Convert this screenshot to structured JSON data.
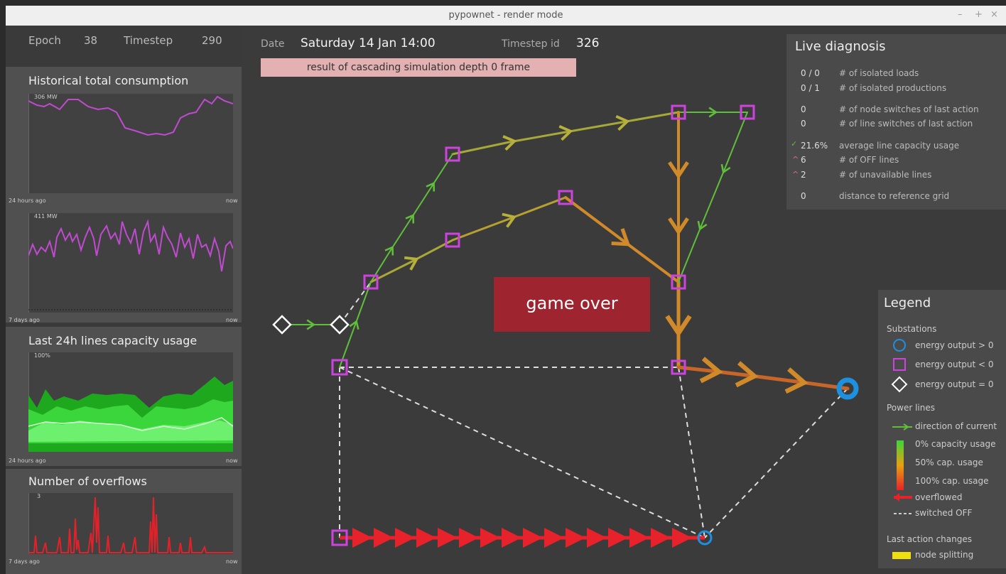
{
  "window": {
    "title": "pypownet - render mode",
    "controls": [
      "–",
      "+",
      "×"
    ]
  },
  "sidebar": {
    "epoch_label": "Epoch",
    "epoch_value": "38",
    "timestep_label": "Timestep",
    "timestep_value": "290",
    "consumption": {
      "title": "Historical total consumption",
      "top_label_1": "306 MW",
      "x_left_1": "24 hours ago",
      "x_right_1": "now",
      "top_label_2": "411 MW",
      "x_left_2": "7 days ago",
      "x_right_2": "now"
    },
    "capacity": {
      "title": "Last 24h lines capacity usage",
      "top_label": "100%",
      "x_left": "24 hours ago",
      "x_right": "now"
    },
    "overflows": {
      "title": "Number of overflows",
      "top_label": "3",
      "x_left": "7 days ago",
      "x_right": "now"
    }
  },
  "header": {
    "date_label": "Date",
    "date_value": "Saturday 14 Jan  14:00",
    "timestep_id_label": "Timestep id",
    "timestep_id_value": "326",
    "banner": "result of cascading simulation depth 0 frame"
  },
  "game_over": "game over",
  "diagnosis": {
    "title": "Live diagnosis",
    "rows": [
      {
        "value": "0 / 0",
        "label": "# of isolated loads"
      },
      {
        "value": "0 / 1",
        "label": "# of isolated productions"
      },
      {
        "value": "0",
        "label": "# of node switches of last action"
      },
      {
        "value": "0",
        "label": "# of line switches of last action"
      },
      {
        "value": "21.6%",
        "label": "average line capacity usage"
      },
      {
        "value": "6",
        "label": "# of OFF lines"
      },
      {
        "value": "2",
        "label": "# of unavailable lines"
      },
      {
        "value": "0",
        "label": "distance to reference grid"
      }
    ]
  },
  "legend": {
    "title": "Legend",
    "substations": "Substations",
    "sub_pos": "energy output > 0",
    "sub_neg": "energy output < 0",
    "sub_zero": "energy output = 0",
    "power_lines": "Power lines",
    "direction": "direction of current",
    "cap0": "0% capacity usage",
    "cap50": "50% cap. usage",
    "cap100": "100% cap. usage",
    "overflowed": "overflowed",
    "switched_off": "switched OFF",
    "last_action": "Last action changes",
    "node_splitting": "node splitting"
  },
  "colors": {
    "substation_neg": "#cc44dd",
    "substation_pos": "#1e90e0",
    "line_low": "#5fbf3a",
    "line_mid": "#c9a030",
    "line_high": "#d07a20",
    "overflow": "#e8222a",
    "gameover_bg": "#9e2430"
  }
}
